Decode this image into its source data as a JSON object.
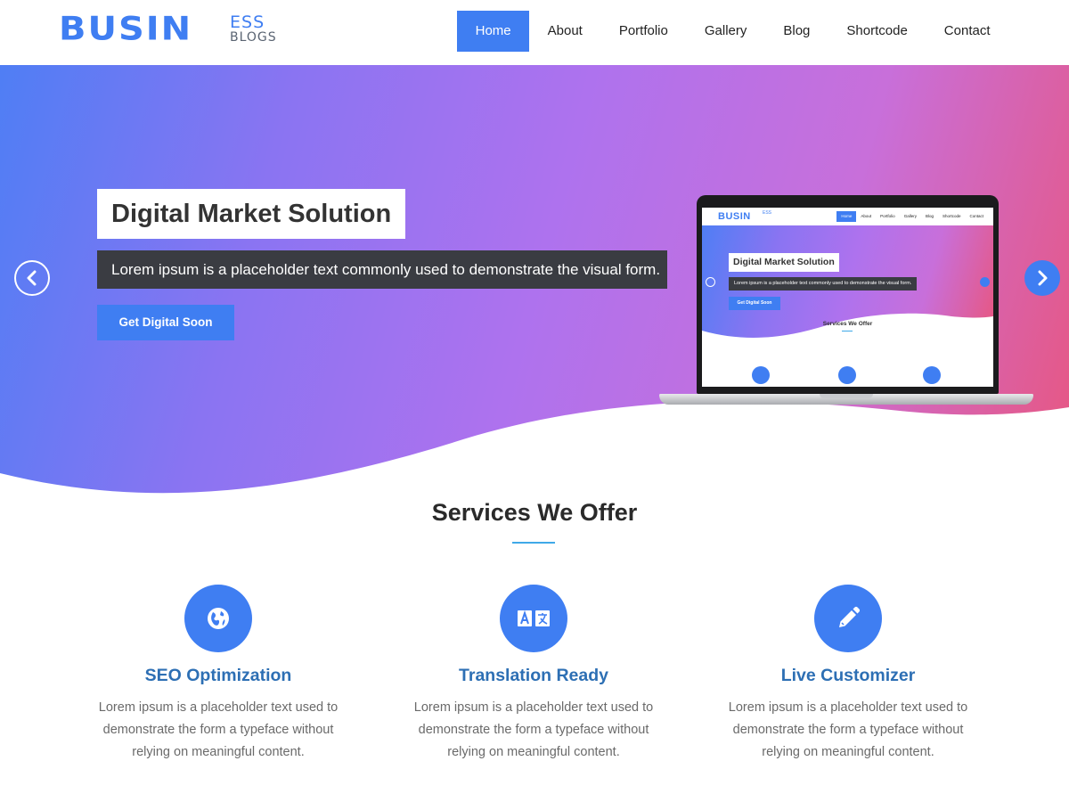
{
  "logo": {
    "main": "BUSIN",
    "top": "ESS",
    "bottom": "BLOGS"
  },
  "nav": {
    "items": [
      {
        "label": "Home",
        "active": true
      },
      {
        "label": "About",
        "active": false
      },
      {
        "label": "Portfolio",
        "active": false
      },
      {
        "label": "Gallery",
        "active": false
      },
      {
        "label": "Blog",
        "active": false
      },
      {
        "label": "Shortcode",
        "active": false
      },
      {
        "label": "Contact",
        "active": false
      }
    ]
  },
  "hero": {
    "title": "Digital Market Solution",
    "subtitle": "Lorem ipsum is a placeholder text commonly used to demonstrate the visual form.",
    "button": "Get Digital Soon",
    "prev_icon": "chevron-left-icon",
    "next_icon": "chevron-right-icon"
  },
  "mockup": {
    "logo_main": "BUSIN",
    "logo_small": "ESS",
    "nav": [
      "Home",
      "About",
      "Portfolio",
      "Gallery",
      "Blog",
      "Shortcode",
      "Contact"
    ],
    "title": "Digital Market Solution",
    "subtitle": "Lorem ipsum is a placeholder text commonly used to demonstrate the visual form.",
    "button": "Get Digital Soon",
    "services_title": "Services We Offer"
  },
  "services": {
    "title": "Services We Offer",
    "items": [
      {
        "icon": "globe-icon",
        "title": "SEO Optimization",
        "desc": "Lorem ipsum is a placeholder text used to demonstrate the form a typeface without relying on meaningful content."
      },
      {
        "icon": "translate-icon",
        "title": "Translation Ready",
        "desc": "Lorem ipsum is a placeholder text used to demonstrate the form a typeface without relying on meaningful content."
      },
      {
        "icon": "pencil-icon",
        "title": "Live Customizer",
        "desc": "Lorem ipsum is a placeholder text used to demonstrate the form a typeface without relying on meaningful content."
      }
    ]
  },
  "colors": {
    "accent": "#3f7ef2",
    "title_blue": "#2d6fb4",
    "underline": "#3fa9e8",
    "dark_box": "#3a3c42"
  }
}
